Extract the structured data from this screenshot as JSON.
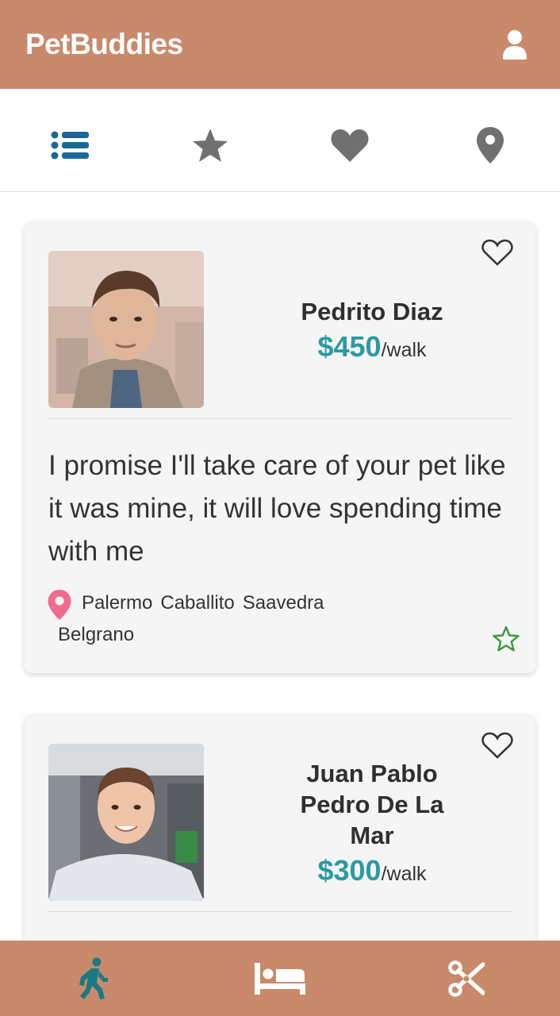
{
  "app": {
    "title": "PetBuddies"
  },
  "header": {
    "profile_icon": "user-icon"
  },
  "filters": [
    {
      "icon": "list-icon",
      "active": true
    },
    {
      "icon": "star-icon",
      "active": false
    },
    {
      "icon": "heart-icon",
      "active": false
    },
    {
      "icon": "map-pin-icon",
      "active": false
    }
  ],
  "walkers": [
    {
      "name": "Pedrito Diaz",
      "price": "$450",
      "unit": "/walk",
      "description": "I promise I'll take care of your pet like it was mine, it will love spending time with me",
      "locations": [
        "Palermo",
        "Caballito",
        "Saavedra",
        "Belgrano"
      ]
    },
    {
      "name": "Juan Pablo Pedro De La Mar",
      "price": "$300",
      "unit": "/walk"
    }
  ],
  "bottom_nav": [
    {
      "icon": "walking-icon",
      "active": true
    },
    {
      "icon": "bed-icon",
      "active": false
    },
    {
      "icon": "scissors-icon",
      "active": false
    }
  ],
  "colors": {
    "brand": "#c98a6c",
    "price": "#2a9aa3",
    "active_icon": "#1a6896",
    "inactive_icon": "#707070",
    "pin": "#f06b8e",
    "star": "#3a9a3a"
  }
}
